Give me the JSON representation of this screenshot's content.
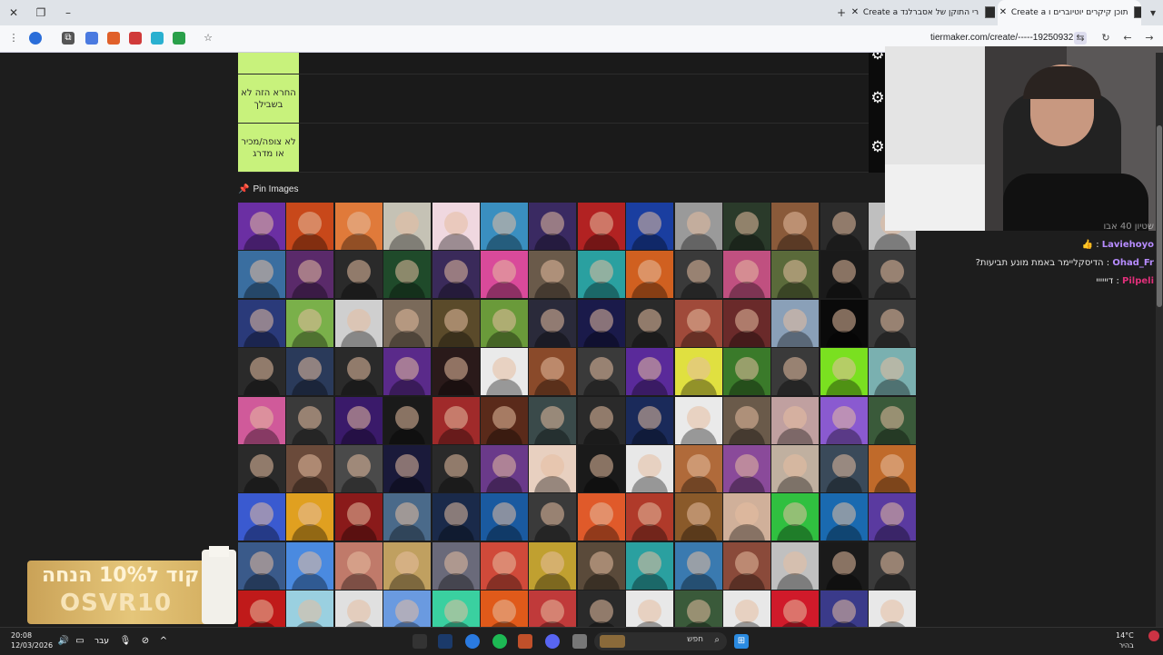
{
  "browser": {
    "tabs": [
      {
        "label": "Create a תוכן קיקרים יוטיוברים ו",
        "active": true
      },
      {
        "label": "Create a רי התוקן של אסברלנד",
        "active": false
      }
    ],
    "url": "tiermaker.com/create/-----19250932"
  },
  "tiers": [
    {
      "label": ""
    },
    {
      "label": "החרא הזה לא בשבילך"
    },
    {
      "label": "לא צופה/מכיר או מדרג"
    }
  ],
  "pin": {
    "label": "Pin Images"
  },
  "grid": {
    "rows": 9,
    "cols": 14,
    "colors": [
      "#6b2fa3",
      "#c8481a",
      "#e07a3a",
      "#c5c2b5",
      "#f0d8e0",
      "#3a8fc0",
      "#3a2a62",
      "#b22222",
      "#1a3ea0",
      "#9a9a9a",
      "#2a3a2a",
      "#8a5a3a",
      "#2a2a2a",
      "#bfbfbf",
      "#3a6ea0",
      "#5a2a6a",
      "#2a2a2a",
      "#1f4a2a",
      "#3a2a5a",
      "#d94a9a",
      "#6a5a4a",
      "#2aa0a0",
      "#d06020",
      "#3a3a3a",
      "#c05080",
      "#5a6a3a",
      "#1a1a1a",
      "#3a3a3a",
      "#2a3a7a",
      "#7ab04a",
      "#cfcfcf",
      "#7a6a5a",
      "#5a4a2a",
      "#6a9a3a",
      "#2a2a3a",
      "#1a1a4a",
      "#2a2a2a",
      "#a04a3a",
      "#6a2a2a",
      "#8aa0b8",
      "#0a0a0a",
      "#3a3a3a",
      "#2a2a2a",
      "#2a3a5a",
      "#2a2a2a",
      "#5a2a8a",
      "#2a1a1a",
      "#eaeaea",
      "#8a4a2a",
      "#3a3a3a",
      "#5a2a9a",
      "#e0e040",
      "#3a7a2a",
      "#3a3a3a",
      "#7ae020",
      "#7ab0b0",
      "#d05a9a",
      "#3a3a3a",
      "#3a1a6a",
      "#1a1a1a",
      "#a02a2a",
      "#5a2a1a",
      "#3a4a4a",
      "#2a2a2a",
      "#1a2a5a",
      "#eaeaea",
      "#6a5a4a",
      "#c0a0a0",
      "#8a5ad0",
      "#3a5a3a",
      "#2a2a2a",
      "#6a4a3a",
      "#4a4a4a",
      "#1a1a3a",
      "#2a2a2a",
      "#6a3a8a",
      "#e8d0c0",
      "#1a1a1a",
      "#e8e8e8",
      "#b06a3a",
      "#8a4a9a",
      "#c0b0a0",
      "#3a4a5a",
      "#c06a2a",
      "#3a5ad0",
      "#e0a020",
      "#8a1a1a",
      "#4a6a8a",
      "#1a2a4a",
      "#1a5aa0",
      "#3a3a3a",
      "#e05a2a",
      "#b03a2a",
      "#8a5a2a",
      "#d0b09a",
      "#30c040",
      "#1a6ab0",
      "#5a3aa0",
      "#3a5a8a",
      "#4a8ae0",
      "#c07a6a",
      "#c0a060",
      "#6a6a7a",
      "#d04a3a",
      "#c0a030",
      "#5a4a3a",
      "#2aa0a0",
      "#3a7ab0",
      "#8a4a3a",
      "#c0c0c0",
      "#1a1a1a",
      "#3a3a3a",
      "#c01a1a",
      "#9ad0e0",
      "#e0e0e0",
      "#6a9ae0",
      "#3ad0a0",
      "#e05a1a",
      "#c03a3a",
      "#2a2a2a",
      "#e8e8e8",
      "#3a5a3a",
      "#e8e8e8",
      "#d01a2a",
      "#3a3a8a",
      "#e8e8e8"
    ]
  },
  "chat": {
    "header": "שטיון 40 אבו",
    "messages": [
      {
        "user": "Laviehoyo",
        "user_color": "#b78cff",
        "text": "👍"
      },
      {
        "user": "Ohad_Fr",
        "user_color": "#b78cff",
        "text": "הדיסקליימר באמת מונע תביעות?"
      },
      {
        "user": "Pilpeli",
        "user_color": "#e0307a",
        "text": "דיייייי"
      }
    ]
  },
  "promo": {
    "line1": "קוד ל10% הנחה",
    "line2": "OSVR10"
  },
  "taskbar": {
    "time": "20:08",
    "date": "12/03/2026",
    "lang": "עבר",
    "search": "חפש",
    "weather_temp": "14°C",
    "weather_text": "בהיר"
  }
}
